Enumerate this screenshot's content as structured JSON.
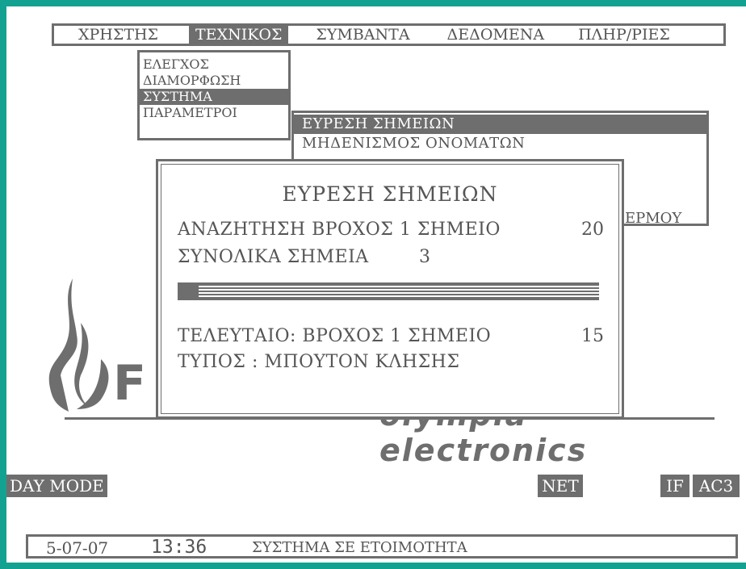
{
  "menubar": {
    "items": [
      "ΧΡΗΣΤΗΣ",
      "ΤΕΧΝΙΚΟΣ",
      "ΣΥΜΒΑΝΤΑ",
      "ΔΕΔΟΜΕΝΑ",
      "ΠΛΗΡ/ΡΙΕΣ"
    ],
    "active": "ΤΕΧΝΙΚΟΣ"
  },
  "dropdown": {
    "items": [
      "ΕΛΕΓΧΟΣ",
      "ΔΙΑΜΟΡΦΩΣΗ",
      "ΣΥΣΤΗΜΑ",
      "ΠΑΡΑΜΕΤΡΟΙ"
    ],
    "active": "ΣΥΣΤΗΜΑ"
  },
  "submenu": {
    "items": [
      "ΕΥΡΕΣΗ ΣΗΜΕΙΩΝ",
      "ΜΗΔΕΝΙΣΜΟΣ ΟΝΟΜΑΤΩΝ"
    ],
    "active": "ΕΥΡΕΣΗ ΣΗΜΕΙΩΝ",
    "partial_item": "ΕΡΜΟΥ"
  },
  "logo": {
    "letters": "F",
    "brand": "olympia electronics"
  },
  "dialog": {
    "title": "ΕΥΡΕΣΗ ΣΗΜΕΙΩΝ",
    "search_label": "ΑΝΑΖΗΤΗΣΗ ΒΡΟΧΟΣ 1 ΣΗΜΕΙΟ",
    "search_value": "20",
    "total_label": "ΣΥΝΟΛΙΚΑ ΣΗΜΕΙΑ",
    "total_value": "3",
    "progress_fraction": 0.05,
    "last_label": "ΤΕΛΕΥΤΑΙΟ: ΒΡΟΧΟΣ 1 ΣΗΜΕΙΟ",
    "last_value": "15",
    "type_label": "ΤΥΠΟΣ : ΜΠΟΥΤΟΝ ΚΛΗΣΗΣ"
  },
  "status": {
    "day_mode": "DAY MODE",
    "net": "NET",
    "if": "IF",
    "ac3": "AC3",
    "date": "5-07-07",
    "time": "13:36",
    "message": "ΣΥΣΤΗΜΑ ΣΕ ΕΤΟΙΜΟΤΗΤΑ"
  },
  "colors": {
    "frame": "#13a291",
    "ui_gray": "#6e6e6e"
  }
}
